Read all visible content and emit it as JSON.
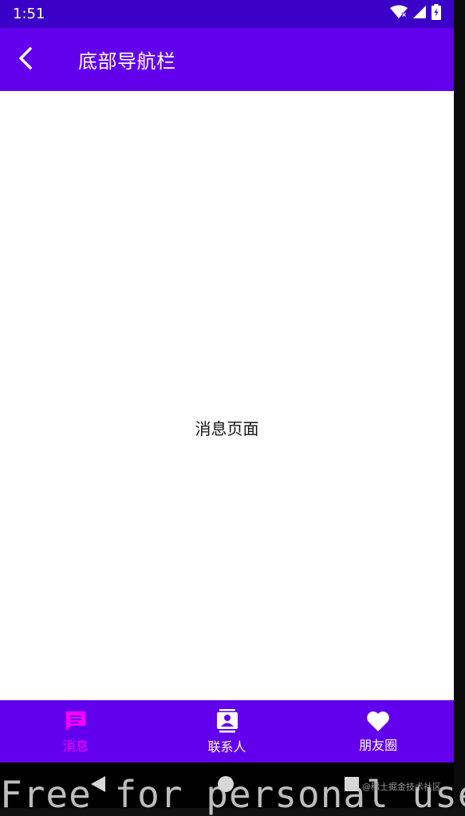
{
  "status_bar": {
    "time": "1:51"
  },
  "app_bar": {
    "back_icon": "chevron-left-icon",
    "title": "底部导航栏"
  },
  "content": {
    "page_text": "消息页面"
  },
  "bottom_nav": {
    "items": [
      {
        "label": "消息",
        "icon": "message-icon",
        "active": true
      },
      {
        "label": "联系人",
        "icon": "contacts-icon",
        "active": false
      },
      {
        "label": "朋友圈",
        "icon": "heart-icon",
        "active": false
      }
    ]
  },
  "system_nav": {
    "buttons": [
      "back-icon",
      "home-icon",
      "recents-icon"
    ]
  },
  "overlay": {
    "watermark": "Free for personal use",
    "credit": "@稀土掘金技术社区"
  },
  "colors": {
    "primary": "#6200ee",
    "status_bar": "#3a00c8",
    "active": "#ff00ff",
    "inactive": "#ffffff"
  }
}
